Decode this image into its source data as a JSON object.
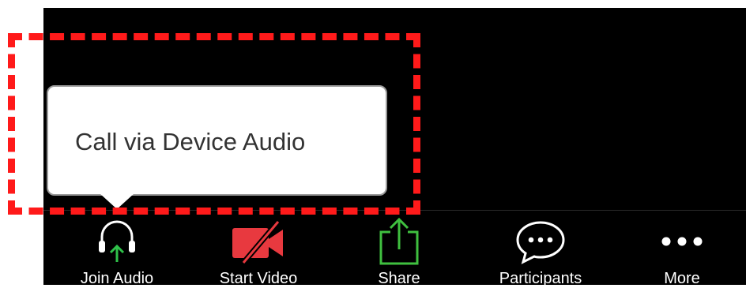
{
  "tooltip": {
    "text": "Call via Device Audio"
  },
  "toolbar": {
    "join_audio_label": "Join Audio",
    "start_video_label": "Start Video",
    "share_label": "Share",
    "participants_label": "Participants",
    "more_label": "More"
  },
  "colors": {
    "background": "#000000",
    "highlight": "#ff1a1a",
    "video_off": "#e8393f",
    "share": "#3fbf3f",
    "audio_arrow": "#2fc14a",
    "label": "#ffffff"
  },
  "icons": {
    "join_audio": "headphones-icon",
    "start_video": "video-off-icon",
    "share": "share-icon",
    "participants": "chat-bubble-icon",
    "more": "more-dots-icon"
  }
}
